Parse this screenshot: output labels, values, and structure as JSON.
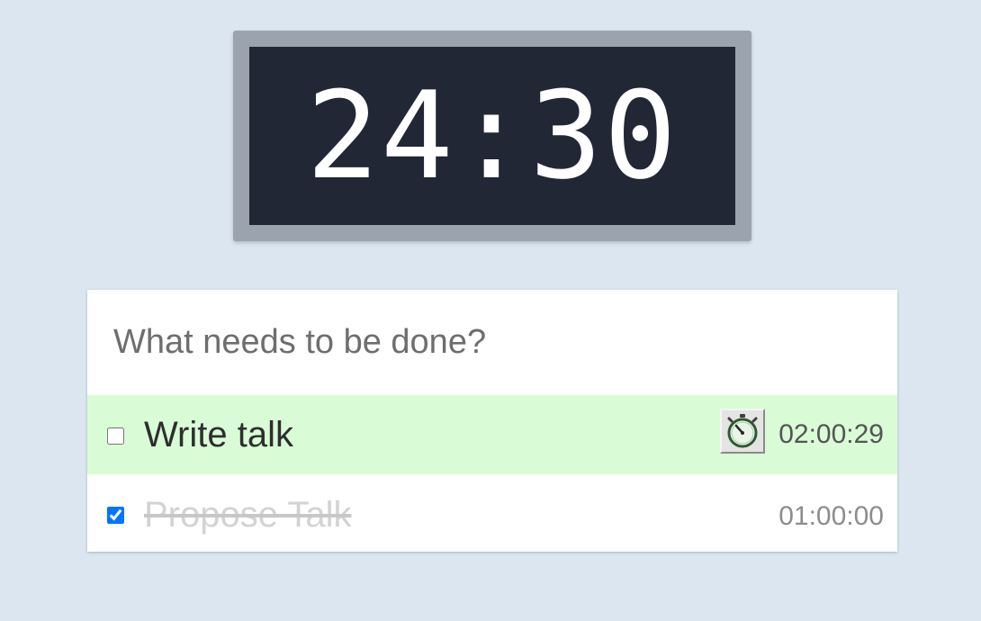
{
  "timer": {
    "display": "24:30"
  },
  "new_todo": {
    "placeholder": "What needs to be done?",
    "value": ""
  },
  "todos": [
    {
      "title": "Write talk",
      "completed": false,
      "time": "02:00:29",
      "running": true,
      "icon": "stopwatch-icon"
    },
    {
      "title": "Propose Talk",
      "completed": true,
      "time": "01:00:00",
      "running": false
    }
  ],
  "colors": {
    "background": "#dbe6f0",
    "timer_frame": "#9aa3ae",
    "timer_screen": "#212734",
    "active_row": "#d9fcd7"
  }
}
